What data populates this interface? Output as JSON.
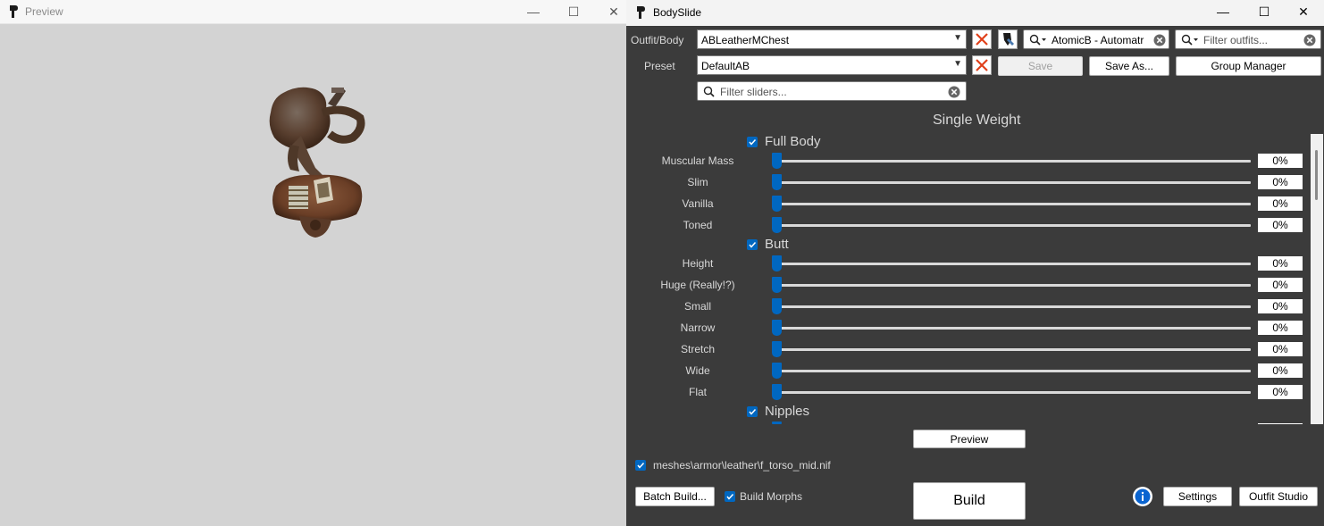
{
  "preview": {
    "title": "Preview",
    "controls": {
      "minimize": "—",
      "maximize": "☐",
      "close": "✕"
    }
  },
  "bodyslide": {
    "title": "BodySlide",
    "controls": {
      "minimize": "—",
      "maximize": "☐",
      "close": "✕"
    },
    "outfit_label": "Outfit/Body",
    "outfit_value": "ABLeatherMChest",
    "preset_label": "Preset",
    "preset_value": "DefaultAB",
    "group_filter_value": "AtomicB - Automatr",
    "outfit_filter_placeholder": "Filter outfits...",
    "slider_filter_placeholder": "Filter sliders...",
    "save_label": "Save",
    "save_as_label": "Save As...",
    "group_manager_label": "Group Manager",
    "weight_title": "Single Weight",
    "groups": [
      {
        "label": "Full Body",
        "checked": true
      },
      {
        "label": "Butt",
        "checked": true
      },
      {
        "label": "Nipples",
        "checked": true
      }
    ],
    "sliders": {
      "full_body": [
        {
          "name": "Muscular Mass",
          "value": "0%"
        },
        {
          "name": "Slim",
          "value": "0%"
        },
        {
          "name": "Vanilla",
          "value": "0%"
        },
        {
          "name": "Toned",
          "value": "0%"
        }
      ],
      "butt": [
        {
          "name": "Height",
          "value": "0%"
        },
        {
          "name": "Huge (Really!?)",
          "value": "0%"
        },
        {
          "name": "Small",
          "value": "0%"
        },
        {
          "name": "Narrow",
          "value": "0%"
        },
        {
          "name": "Stretch",
          "value": "0%"
        },
        {
          "name": "Wide",
          "value": "0%"
        },
        {
          "name": "Flat",
          "value": "0%"
        }
      ]
    },
    "preview_button": "Preview",
    "mesh_path": "meshes\\armor\\leather\\f_torso_mid.nif",
    "batch_build_label": "Batch Build...",
    "build_morphs_label": "Build Morphs",
    "build_label": "Build",
    "settings_label": "Settings",
    "outfit_studio_label": "Outfit Studio",
    "accent_color": "#0067c0",
    "background_color": "#3b3b3b"
  }
}
